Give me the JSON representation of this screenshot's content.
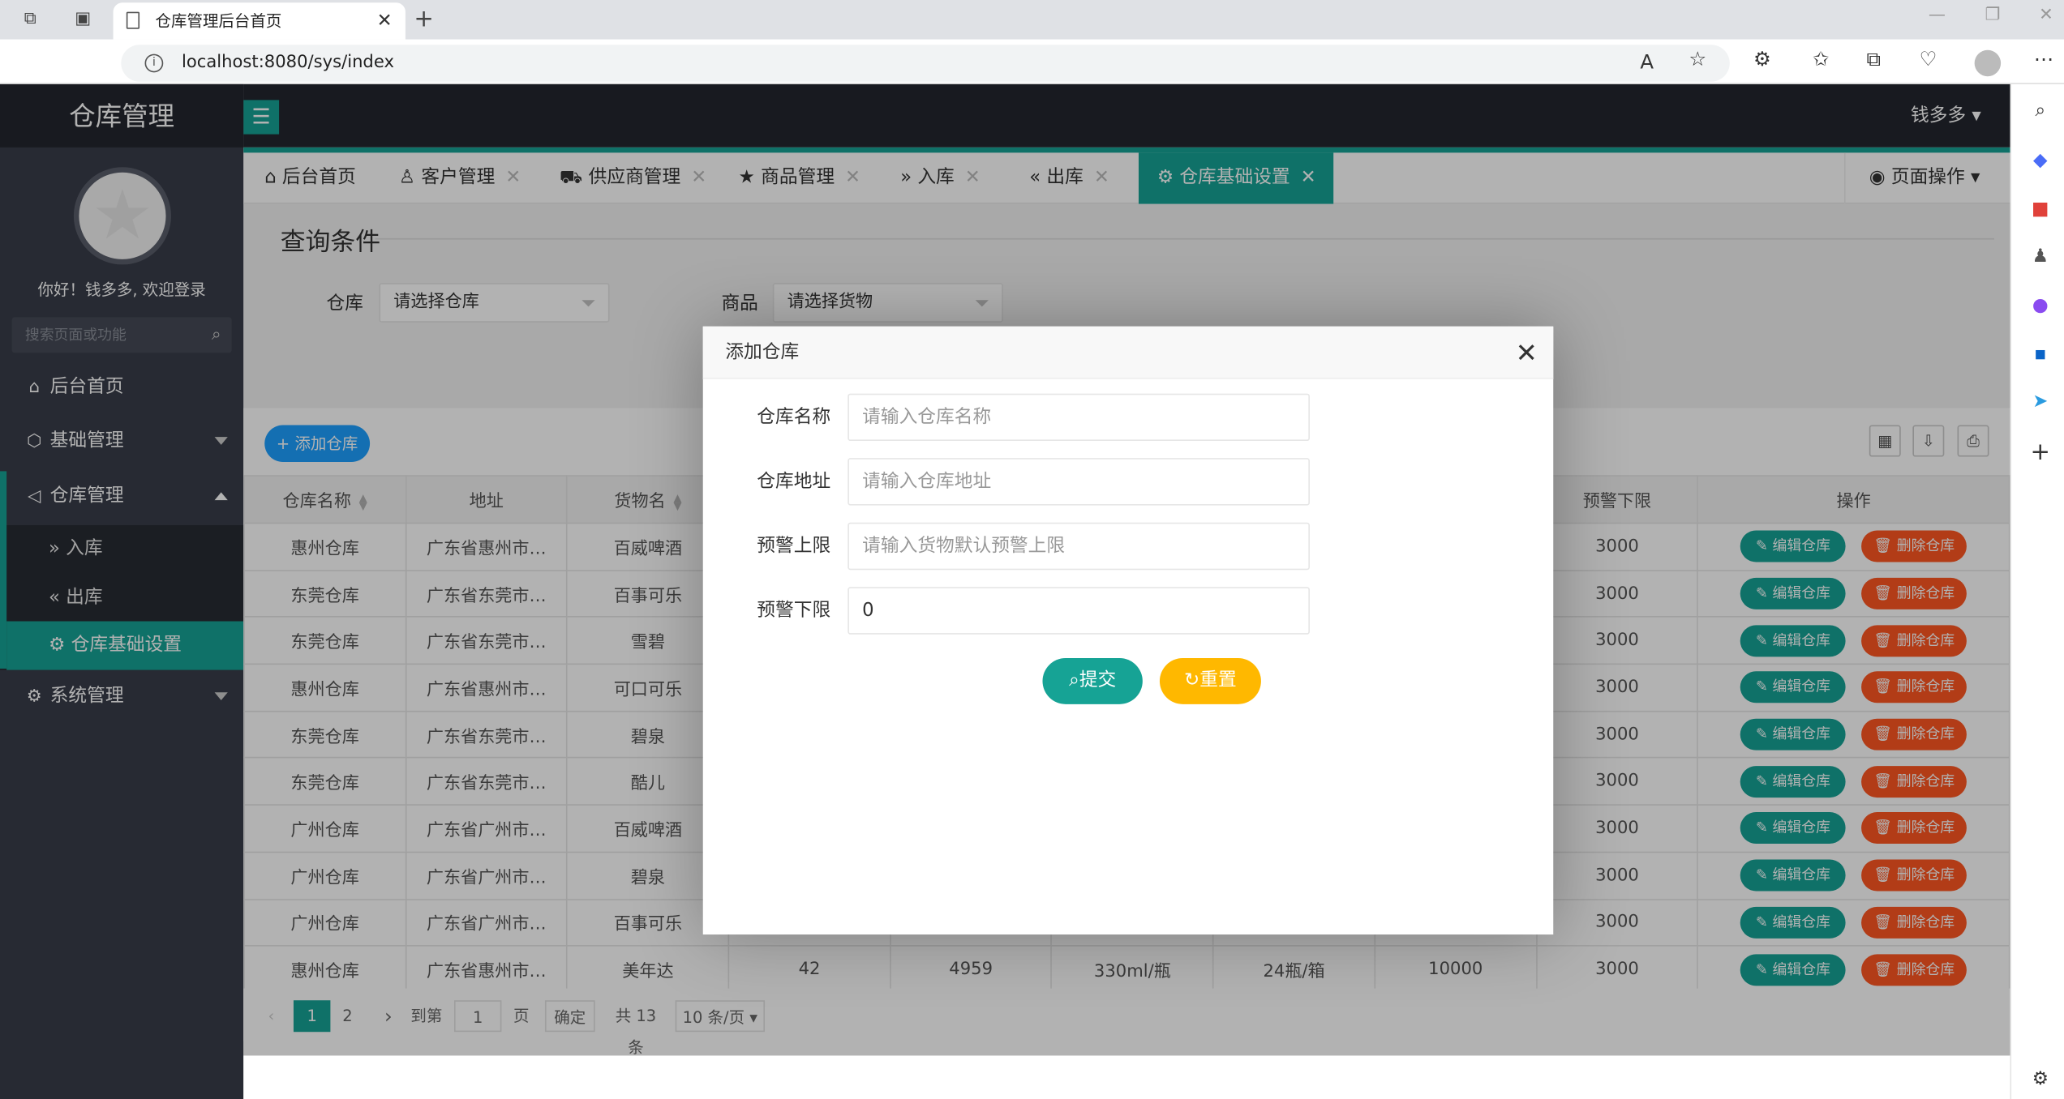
{
  "browser": {
    "tab_title": "仓库管理后台首页",
    "url": "localhost:8080/sys/index"
  },
  "app": {
    "brand": "仓库管理",
    "user_name": "钱多多",
    "greeting": "你好！钱多多, 欢迎登录",
    "search_placeholder": "搜索页面或功能"
  },
  "menu": {
    "home": "后台首页",
    "basic": "基础管理",
    "warehouse": "仓库管理",
    "inbound": "入库",
    "outbound": "出库",
    "warehouse_settings": "仓库基础设置",
    "system": "系统管理"
  },
  "page_tabs": [
    "后台首页",
    "客户管理",
    "供应商管理",
    "商品管理",
    "入库",
    "出库",
    "仓库基础设置"
  ],
  "page_operation": "页面操作",
  "query": {
    "title": "查询条件",
    "warehouse_label": "仓库",
    "warehouse_placeholder": "请选择仓库",
    "goods_label": "商品",
    "goods_placeholder": "请选择货物"
  },
  "table": {
    "add_button": "添加仓库",
    "headers": [
      "仓库名称",
      "地址",
      "货物名",
      "",
      "",
      "",
      "",
      "",
      "预警下限",
      "操作"
    ],
    "edit_label": "编辑仓库",
    "delete_label": "删除仓库",
    "rows": [
      [
        "惠州仓库",
        "广东省惠州市…",
        "百威啤酒",
        "",
        "",
        "",
        "",
        "",
        "3000"
      ],
      [
        "东莞仓库",
        "广东省东莞市…",
        "百事可乐",
        "",
        "",
        "",
        "",
        "",
        "3000"
      ],
      [
        "东莞仓库",
        "广东省东莞市…",
        "雪碧",
        "",
        "",
        "",
        "",
        "",
        "3000"
      ],
      [
        "惠州仓库",
        "广东省惠州市…",
        "可口可乐",
        "",
        "",
        "",
        "",
        "",
        "3000"
      ],
      [
        "东莞仓库",
        "广东省东莞市…",
        "碧泉",
        "",
        "",
        "",
        "",
        "",
        "3000"
      ],
      [
        "东莞仓库",
        "广东省东莞市…",
        "酷儿",
        "",
        "",
        "",
        "",
        "",
        "3000"
      ],
      [
        "广州仓库",
        "广东省广州市…",
        "百威啤酒",
        "",
        "",
        "",
        "",
        "",
        "3000"
      ],
      [
        "广州仓库",
        "广东省广州市…",
        "碧泉",
        "",
        "",
        "",
        "",
        "",
        "3000"
      ],
      [
        "广州仓库",
        "广东省广州市…",
        "百事可乐",
        "",
        "",
        "",
        "",
        "",
        "3000"
      ],
      [
        "惠州仓库",
        "广东省惠州市…",
        "美年达",
        "42",
        "4959",
        "330ml/瓶",
        "24瓶/箱",
        "10000",
        "3000"
      ]
    ]
  },
  "pager": {
    "page1": "1",
    "page2": "2",
    "goto": "到第",
    "page_input": "1",
    "page_unit": "页",
    "confirm": "确定",
    "total": "共 13 条",
    "per_page": "10 条/页"
  },
  "modal": {
    "title": "添加仓库",
    "name_label": "仓库名称",
    "name_placeholder": "请输入仓库名称",
    "addr_label": "仓库地址",
    "addr_placeholder": "请输入仓库地址",
    "upper_label": "预警上限",
    "upper_placeholder": "请输入货物默认预警上限",
    "lower_label": "预警下限",
    "lower_value": "0",
    "submit": "提交",
    "reset": "重置"
  },
  "colors": {
    "accent": "#16a395",
    "blue": "#1e9fff",
    "danger": "#ff5722",
    "warning": "#ffb800",
    "sidebar": "#393d49"
  }
}
